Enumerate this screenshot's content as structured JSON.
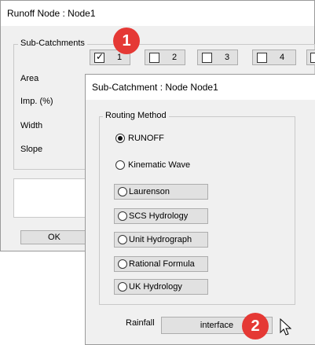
{
  "back_window": {
    "title": "Runoff Node : Node1",
    "subcatchments_legend": "Sub-Catchments",
    "tabs": [
      {
        "label": "1",
        "checked": true
      },
      {
        "label": "2",
        "checked": false
      },
      {
        "label": "3",
        "checked": false
      },
      {
        "label": "4",
        "checked": false
      }
    ],
    "row_labels": {
      "area": "Area",
      "imp": "Imp. (%)",
      "width": "Width",
      "slope": "Slope"
    },
    "ok_label": "OK"
  },
  "front_window": {
    "title": "Sub-Catchment : Node Node1",
    "routing_legend": "Routing Method",
    "runoff_label": "RUNOFF",
    "kinematic_label": "Kinematic Wave",
    "method_buttons": [
      "Laurenson",
      "SCS Hydrology",
      "Unit Hydrograph",
      "Rational Formula",
      "UK Hydrology"
    ],
    "rainfall_label": "Rainfall",
    "interface_label": "interface"
  },
  "badges": [
    "1",
    "2"
  ]
}
